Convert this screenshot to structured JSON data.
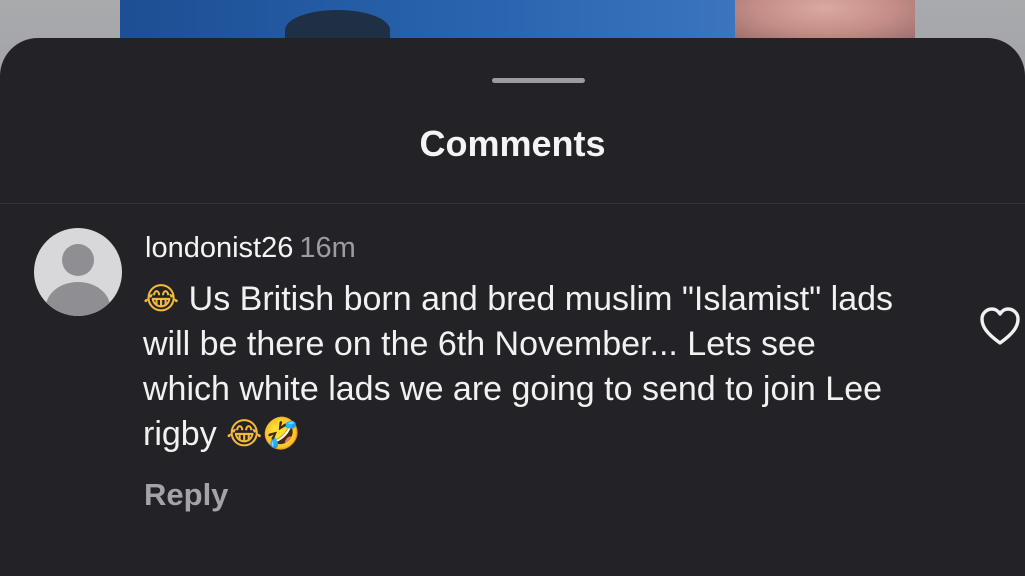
{
  "sheet": {
    "title": "Comments"
  },
  "comment": {
    "username": "londonist26",
    "time": "16m",
    "leading_emoji": "😂",
    "text": " Us British born and bred muslim \"Islamist\" lads will be there on the 6th November... Lets see which white lads we are going to send to join Lee rigby ",
    "trailing_emojis": "😂🤣",
    "reply_label": "Reply",
    "like_icon": "heart-outline-icon"
  },
  "colors": {
    "sheet_background": "#232226",
    "primary_text": "#f4f4f5",
    "secondary_text": "#9d9ca2"
  }
}
